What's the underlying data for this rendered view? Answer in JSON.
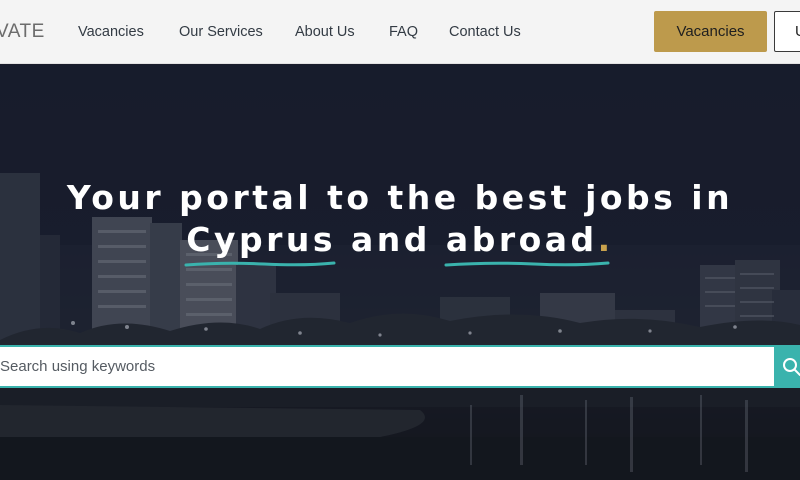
{
  "header": {
    "logo_text": "VATE",
    "nav": [
      {
        "label": "Vacancies"
      },
      {
        "label": "Our Services"
      },
      {
        "label": "About Us"
      },
      {
        "label": "FAQ"
      },
      {
        "label": "Contact Us"
      }
    ],
    "cta_label": "Vacancies",
    "secondary_label": "U"
  },
  "hero": {
    "line1": "Your portal to the best jobs in",
    "word1": "Cyprus",
    "and_text": " and ",
    "word2": "abroad",
    "dot": "."
  },
  "search": {
    "placeholder": "Search using keywords",
    "value": ""
  },
  "colors": {
    "accent_gold": "#bd9a4c",
    "accent_teal": "#3ab3ad"
  },
  "icons": {
    "search_button": "search-icon"
  }
}
